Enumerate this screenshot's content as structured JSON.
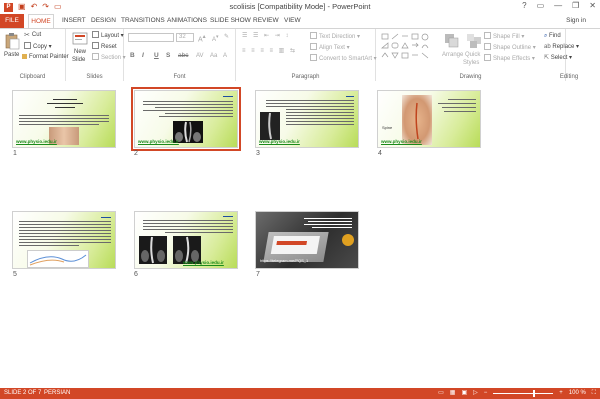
{
  "window": {
    "title": "scoliisis [Compatibility Mode] - PowerPoint",
    "controls": [
      "?",
      "▭",
      "—",
      "❐",
      "✕"
    ],
    "sign_in": "Sign in"
  },
  "quick_access": [
    "save-icon",
    "undo-icon",
    "redo-icon",
    "present-icon"
  ],
  "tabs": [
    {
      "label": "FILE",
      "active": false
    },
    {
      "label": "HOME",
      "active": true
    },
    {
      "label": "INSERT",
      "active": false
    },
    {
      "label": "DESIGN",
      "active": false
    },
    {
      "label": "TRANSITIONS",
      "active": false
    },
    {
      "label": "ANIMATIONS",
      "active": false
    },
    {
      "label": "SLIDE SHOW",
      "active": false
    },
    {
      "label": "REVIEW",
      "active": false
    },
    {
      "label": "VIEW",
      "active": false
    }
  ],
  "ribbon": {
    "clipboard": {
      "label": "Clipboard",
      "paste": "Paste",
      "cut": "Cut",
      "copy": "Copy",
      "format_painter": "Format Painter"
    },
    "slides": {
      "label": "Slides",
      "new_slide_line1": "New",
      "new_slide_line2": "Slide",
      "layout": "Layout",
      "reset": "Reset",
      "section": "Section"
    },
    "font": {
      "label": "Font",
      "font_name": "",
      "font_size": "32",
      "bold": "B",
      "italic": "I",
      "underline": "U",
      "shadow": "S",
      "strike": "abc"
    },
    "paragraph": {
      "label": "Paragraph",
      "text_direction": "Text Direction",
      "align_text": "Align Text",
      "convert_smartart": "Convert to SmartArt"
    },
    "drawing": {
      "label": "Drawing",
      "arrange": "Arrange",
      "quick_styles_line1": "Quick",
      "quick_styles_line2": "Styles",
      "shape_fill": "Shape Fill",
      "shape_outline": "Shape Outline",
      "shape_effects": "Shape Effects"
    },
    "editing": {
      "label": "Editing",
      "find": "Find",
      "replace": "Replace",
      "select": "Select"
    }
  },
  "slides": [
    {
      "number": "1",
      "url": "www.physio.iedu.ir",
      "selected": false
    },
    {
      "number": "2",
      "url": "www.physio.iedu.ir",
      "selected": true
    },
    {
      "number": "3",
      "url": "www.physio.iedu.ir",
      "selected": false
    },
    {
      "number": "4",
      "url": "www.physio.iedu.ir",
      "selected": false,
      "label": "Spine"
    },
    {
      "number": "5",
      "url": "",
      "selected": false
    },
    {
      "number": "6",
      "url": "www.physio.iedu.ir",
      "selected": false
    },
    {
      "number": "7",
      "url": "https://telegram.me/PQS_1",
      "selected": false
    }
  ],
  "statusbar": {
    "slide_info": "SLIDE 2 OF 7",
    "language": "PERSIAN",
    "zoom": "100 %"
  },
  "colors": {
    "accent": "#d24726",
    "slide_green": "#b8dc58",
    "link_green": "#1a8a1a"
  }
}
